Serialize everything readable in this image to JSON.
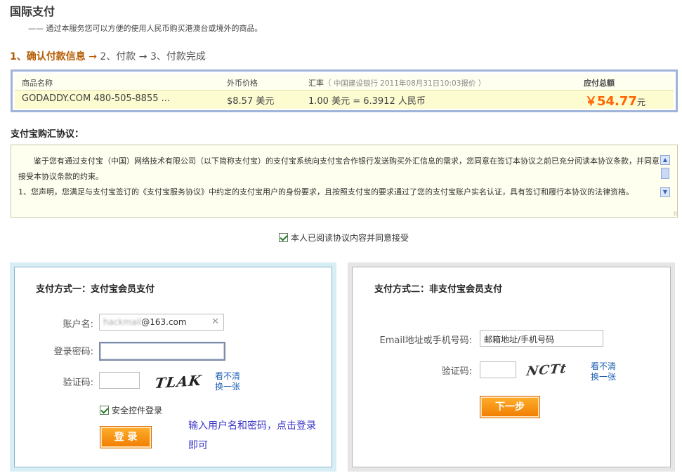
{
  "header": {
    "title": "国际支付",
    "subtitle": "—— 通过本服务您可以方便的使用人民币购买港澳台或境外的商品。"
  },
  "steps": {
    "step1": "1、确认付款信息",
    "arrow": "→",
    "step2": "2、付款",
    "step3": "3、付款完成"
  },
  "order": {
    "headers": {
      "product": "商品名称",
      "foreign_price": "外币价格",
      "rate_label": "汇率",
      "rate_note": "（ 中国建设银行 2011年08月31日10:03报价 ）",
      "total": "应付总额"
    },
    "row": {
      "product": "GODADDY.COM 480-505-8855 ...",
      "foreign_price": "$8.57 美元",
      "rate": "1.00 美元 = 6.3912 人民币",
      "currency_symbol": "￥",
      "total": "54.77",
      "total_unit": "元"
    }
  },
  "agreement": {
    "title": "支付宝购汇协议：",
    "para1": "鉴于您有通过支付宝（中国）网络技术有限公司（以下简称支付宝）的支付宝系统向支付宝合作银行发送购买外汇信息的需求，您同意在签订本协议之前已充分阅读本协议条款，并同意接受本协议条款的约束。",
    "para2": "1、您声明，您满足与支付宝签订的《支付宝服务协议》中约定的支付宝用户的身份要求，且按照支付宝的要求通过了您的支付宝账户实名认证，具有签订和履行本协议的法律资格。",
    "accept_label": "本人已阅读协议内容并同意接受"
  },
  "member_pay": {
    "title": "支付方式一：支付宝会员支付",
    "account_label": "账户名:",
    "account_hidden": "hackmail",
    "account_domain": "@163.com",
    "password_label": "登录密码:",
    "captcha_label": "验证码:",
    "captcha_text": "TLAK",
    "refresh_line1": "看不清",
    "refresh_line2": "换一张",
    "secure_label": "安全控件登录",
    "login_button": "登 录",
    "hint_line1": "输入用户名和密码，点击登录",
    "hint_line2": "即可"
  },
  "guest_pay": {
    "title": "支付方式二：非支付宝会员支付",
    "email_label": "Email地址或手机号码:",
    "email_value": "邮箱地址/手机号码",
    "captcha_label": "验证码:",
    "captcha_text": "NCTt",
    "refresh_line1": "看不清",
    "refresh_line2": "换一张",
    "next_button": "下一步"
  },
  "colors": {
    "accent_orange": "#f60",
    "step_brown": "#b55a00",
    "link_blue": "#1a5fb4",
    "hint_blue": "#3a36c7"
  }
}
